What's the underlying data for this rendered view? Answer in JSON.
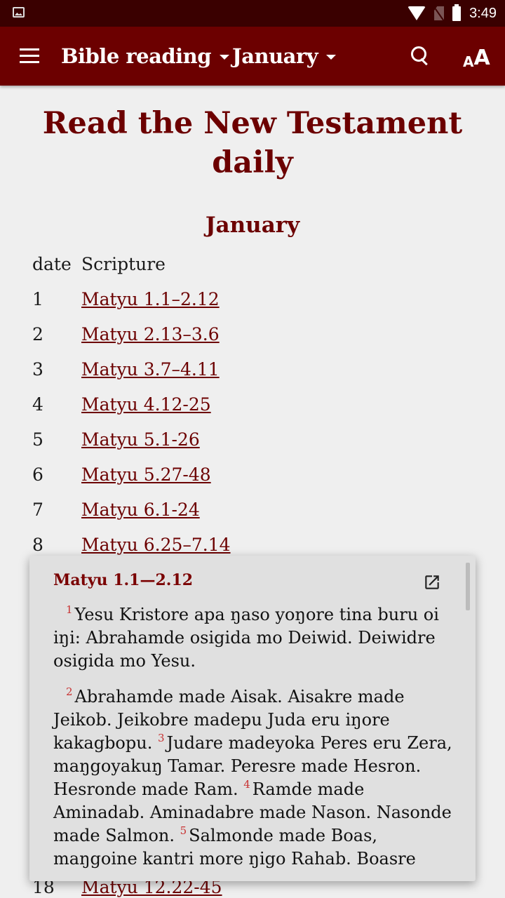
{
  "status_bar": {
    "time": "3:49",
    "icons": [
      "image-notification-icon",
      "wifi-icon",
      "no-sim-icon",
      "battery-icon"
    ]
  },
  "app_bar": {
    "menu_icon": "hamburger-menu-icon",
    "book_dropdown": "Bible reading",
    "month_dropdown": "January",
    "search_icon": "search-icon",
    "font_size_icon": "font-size-icon"
  },
  "page": {
    "title": "Read the New Testament daily",
    "month_heading": "January",
    "table": {
      "headers": {
        "date": "date",
        "scripture": "Scripture"
      },
      "rows": [
        {
          "date": "1",
          "ref": "Matyu 1.1–2.12"
        },
        {
          "date": "2",
          "ref": "Matyu 2.13–3.6"
        },
        {
          "date": "3",
          "ref": "Matyu 3.7–4.11"
        },
        {
          "date": "4",
          "ref": "Matyu 4.12-25"
        },
        {
          "date": "5",
          "ref": "Matyu 5.1-26"
        },
        {
          "date": "6",
          "ref": "Matyu 5.27-48"
        },
        {
          "date": "7",
          "ref": "Matyu 6.1-24"
        },
        {
          "date": "8",
          "ref": "Matyu 6.25–7.14"
        }
      ],
      "visible_bottom_row": {
        "date": "18",
        "ref": "Matyu 12.22-45"
      }
    }
  },
  "popup": {
    "title": "Matyu 1.1—2.12",
    "open_icon": "open-in-new-icon",
    "paragraphs": [
      [
        {
          "verse": "1",
          "text": "Yesu Kristore apa ŋaso yoŋore tina buru oi iŋi: Abrahamde osigida mo Deiwid. Deiwidre osigida mo Yesu."
        }
      ],
      [
        {
          "verse": "2",
          "text": "Abrahamde made Aisak. Aisakre made Jeikob. Jeikobre madepu Juda eru iŋore kakagbopu. "
        },
        {
          "verse": "3",
          "text": "Judare madeyoka Peres eru Zera, maŋgoyakuŋ Tamar. Peresre made Hesron. Hesronde made Ram. "
        },
        {
          "verse": "4",
          "text": "Ramde made Aminadab. Aminadabre made Nason. Nasonde made Salmon. "
        },
        {
          "verse": "5",
          "text": "Salmonde made Boas, maŋgoine kantri more ŋigo Rahab. Boasre"
        }
      ]
    ]
  }
}
